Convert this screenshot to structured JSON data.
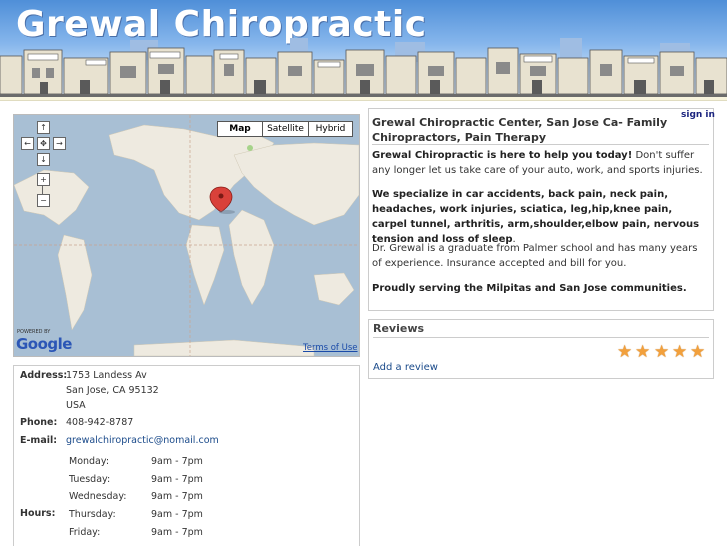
{
  "site": {
    "title": "Grewal Chiropractic",
    "sign_in": "sign in"
  },
  "map": {
    "types": [
      "Map",
      "Satellite",
      "Hybrid"
    ],
    "powered_by": "POWERED BY",
    "google_logo": "Google",
    "terms": "Terms of Use",
    "controls": {
      "up": "↑",
      "left": "←",
      "center": "✥",
      "right": "→",
      "down": "↓",
      "zoom_in": "+",
      "zoom_out": "−"
    }
  },
  "info": {
    "title": "Grewal Chiropractic Center, San Jose Ca- Family Chiropractors, Pain Therapy",
    "p1_bold": "Grewal Chiropractic is here to help you today!",
    "p1_rest": " Don't suffer any longer let us take care of your auto, work, and sports injuries.",
    "p2": "We specialize in car accidents, back pain, neck pain, headaches, work injuries, sciatica, leg,hip,knee pain, carpel tunnel, arthritis, arm,shoulder,elbow pain, nervous tension and loss of sleep",
    "p2_end": ".",
    "p3": "Dr. Grewal is a graduate from Palmer school and has many years of experience. Insurance accepted and bill for you.",
    "p4": "Proudly serving the Milpitas and San Jose communities."
  },
  "reviews": {
    "title": "Reviews",
    "rating": 5,
    "add_label": "Add a review"
  },
  "details": {
    "address_label": "Address:",
    "address_lines": [
      "1753 Landess Av",
      "San Jose, CA 95132",
      "USA"
    ],
    "phone_label": "Phone:",
    "phone": "408-942-8787",
    "email_label": "E-mail:",
    "email": "grewalchiropractic@nomail.com",
    "hours_label": "Hours:",
    "hours": [
      {
        "day": "Monday:",
        "time": "9am - 7pm"
      },
      {
        "day": "Tuesday:",
        "time": "9am - 7pm"
      },
      {
        "day": "Wednesday:",
        "time": "9am - 7pm"
      },
      {
        "day": "Thursday:",
        "time": "9am - 7pm"
      },
      {
        "day": "Friday:",
        "time": "9am - 7pm"
      }
    ]
  },
  "colors": {
    "accent_link": "#1a4a8a",
    "star": "#f2a03c",
    "header_sky": "#86b6ec"
  }
}
